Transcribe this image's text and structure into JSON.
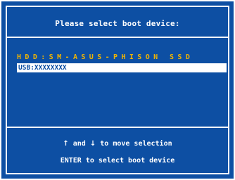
{
  "title": "Please select boot device:",
  "devices": [
    {
      "label": "HDD:SM-ASUS-PHISON SSD",
      "selected": false
    },
    {
      "label": "USB:XXXXXXXX",
      "selected": true
    }
  ],
  "help": {
    "up_arrow": "↑",
    "and_text": " and ",
    "down_arrow": "↓",
    "move_text": " to move selection",
    "enter_line": "ENTER to select boot device"
  },
  "colors": {
    "background": "#0d4fa3",
    "text": "#ffffff",
    "hdd_text": "#f0b400",
    "selection_bg": "#ffffff"
  }
}
